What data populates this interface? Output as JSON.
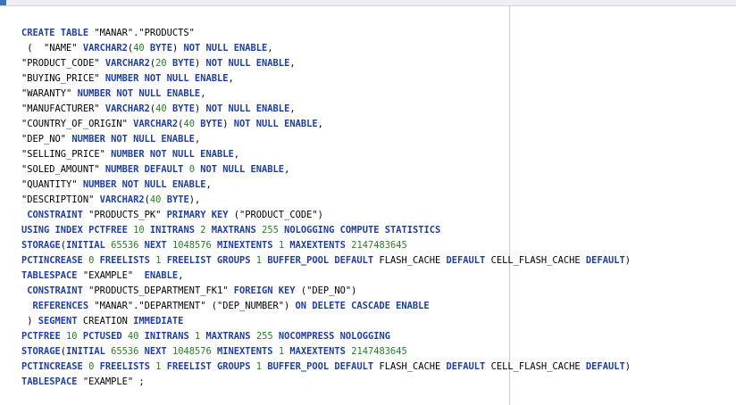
{
  "editor": {
    "lines": [
      [
        {
          "k": "kw",
          "t": "CREATE TABLE "
        },
        {
          "k": "txt",
          "t": "\"MANAR\".\"PRODUCTS\""
        }
      ],
      [
        {
          "k": "txt",
          "t": " (  \"NAME\" "
        },
        {
          "k": "kw",
          "t": "VARCHAR2"
        },
        {
          "k": "txt",
          "t": "("
        },
        {
          "k": "num",
          "t": "40"
        },
        {
          "k": "txt",
          "t": " "
        },
        {
          "k": "kw",
          "t": "BYTE"
        },
        {
          "k": "txt",
          "t": ") "
        },
        {
          "k": "kw",
          "t": "NOT NULL ENABLE"
        },
        {
          "k": "txt",
          "t": ","
        }
      ],
      [
        {
          "k": "txt",
          "t": "\"PRODUCT_CODE\" "
        },
        {
          "k": "kw",
          "t": "VARCHAR2"
        },
        {
          "k": "txt",
          "t": "("
        },
        {
          "k": "num",
          "t": "20"
        },
        {
          "k": "txt",
          "t": " "
        },
        {
          "k": "kw",
          "t": "BYTE"
        },
        {
          "k": "txt",
          "t": ") "
        },
        {
          "k": "kw",
          "t": "NOT NULL ENABLE"
        },
        {
          "k": "txt",
          "t": ","
        }
      ],
      [
        {
          "k": "txt",
          "t": "\"BUYING_PRICE\" "
        },
        {
          "k": "kw",
          "t": "NUMBER NOT NULL ENABLE"
        },
        {
          "k": "txt",
          "t": ","
        }
      ],
      [
        {
          "k": "txt",
          "t": "\"WARANTY\" "
        },
        {
          "k": "kw",
          "t": "NUMBER NOT NULL ENABLE"
        },
        {
          "k": "txt",
          "t": ","
        }
      ],
      [
        {
          "k": "txt",
          "t": "\"MANUFACTURER\" "
        },
        {
          "k": "kw",
          "t": "VARCHAR2"
        },
        {
          "k": "txt",
          "t": "("
        },
        {
          "k": "num",
          "t": "40"
        },
        {
          "k": "txt",
          "t": " "
        },
        {
          "k": "kw",
          "t": "BYTE"
        },
        {
          "k": "txt",
          "t": ") "
        },
        {
          "k": "kw",
          "t": "NOT NULL ENABLE"
        },
        {
          "k": "txt",
          "t": ","
        }
      ],
      [
        {
          "k": "txt",
          "t": "\"COUNTRY_OF_ORIGIN\" "
        },
        {
          "k": "kw",
          "t": "VARCHAR2"
        },
        {
          "k": "txt",
          "t": "("
        },
        {
          "k": "num",
          "t": "40"
        },
        {
          "k": "txt",
          "t": " "
        },
        {
          "k": "kw",
          "t": "BYTE"
        },
        {
          "k": "txt",
          "t": ") "
        },
        {
          "k": "kw",
          "t": "NOT NULL ENABLE"
        },
        {
          "k": "txt",
          "t": ","
        }
      ],
      [
        {
          "k": "txt",
          "t": "\"DEP_NO\" "
        },
        {
          "k": "kw",
          "t": "NUMBER NOT NULL ENABLE"
        },
        {
          "k": "txt",
          "t": ","
        }
      ],
      [
        {
          "k": "txt",
          "t": "\"SELLING_PRICE\" "
        },
        {
          "k": "kw",
          "t": "NUMBER NOT NULL ENABLE"
        },
        {
          "k": "txt",
          "t": ","
        }
      ],
      [
        {
          "k": "txt",
          "t": "\"SOLED_AMOUNT\" "
        },
        {
          "k": "kw",
          "t": "NUMBER DEFAULT "
        },
        {
          "k": "num",
          "t": "0"
        },
        {
          "k": "txt",
          "t": " "
        },
        {
          "k": "kw",
          "t": "NOT NULL ENABLE"
        },
        {
          "k": "txt",
          "t": ","
        }
      ],
      [
        {
          "k": "txt",
          "t": "\"QUANTITY\" "
        },
        {
          "k": "kw",
          "t": "NUMBER NOT NULL ENABLE"
        },
        {
          "k": "txt",
          "t": ","
        }
      ],
      [
        {
          "k": "txt",
          "t": "\"DESCRIPTION\" "
        },
        {
          "k": "kw",
          "t": "VARCHAR2"
        },
        {
          "k": "txt",
          "t": "("
        },
        {
          "k": "num",
          "t": "40"
        },
        {
          "k": "txt",
          "t": " "
        },
        {
          "k": "kw",
          "t": "BYTE"
        },
        {
          "k": "txt",
          "t": "),"
        }
      ],
      [
        {
          "k": "txt",
          "t": " "
        },
        {
          "k": "kw",
          "t": "CONSTRAINT"
        },
        {
          "k": "txt",
          "t": " \"PRODUCTS_PK\" "
        },
        {
          "k": "kw",
          "t": "PRIMARY KEY"
        },
        {
          "k": "txt",
          "t": " (\"PRODUCT_CODE\")"
        }
      ],
      [
        {
          "k": "kw",
          "t": "USING INDEX PCTFREE "
        },
        {
          "k": "num",
          "t": "10"
        },
        {
          "k": "txt",
          "t": " "
        },
        {
          "k": "kw",
          "t": "INITRANS "
        },
        {
          "k": "num",
          "t": "2"
        },
        {
          "k": "txt",
          "t": " "
        },
        {
          "k": "kw",
          "t": "MAXTRANS "
        },
        {
          "k": "num",
          "t": "255"
        },
        {
          "k": "txt",
          "t": " "
        },
        {
          "k": "kw",
          "t": "NOLOGGING COMPUTE STATISTICS"
        }
      ],
      [
        {
          "k": "kw",
          "t": "STORAGE"
        },
        {
          "k": "txt",
          "t": "("
        },
        {
          "k": "kw",
          "t": "INITIAL "
        },
        {
          "k": "num",
          "t": "65536"
        },
        {
          "k": "txt",
          "t": " "
        },
        {
          "k": "kw",
          "t": "NEXT "
        },
        {
          "k": "num",
          "t": "1048576"
        },
        {
          "k": "txt",
          "t": " "
        },
        {
          "k": "kw",
          "t": "MINEXTENTS "
        },
        {
          "k": "num",
          "t": "1"
        },
        {
          "k": "txt",
          "t": " "
        },
        {
          "k": "kw",
          "t": "MAXEXTENTS "
        },
        {
          "k": "num",
          "t": "2147483645"
        }
      ],
      [
        {
          "k": "kw",
          "t": "PCTINCREASE "
        },
        {
          "k": "num",
          "t": "0"
        },
        {
          "k": "txt",
          "t": " "
        },
        {
          "k": "kw",
          "t": "FREELISTS "
        },
        {
          "k": "num",
          "t": "1"
        },
        {
          "k": "txt",
          "t": " "
        },
        {
          "k": "kw",
          "t": "FREELIST GROUPS "
        },
        {
          "k": "num",
          "t": "1"
        },
        {
          "k": "txt",
          "t": " "
        },
        {
          "k": "kw",
          "t": "BUFFER_POOL DEFAULT"
        },
        {
          "k": "txt",
          "t": " FLASH_CACHE "
        },
        {
          "k": "kw",
          "t": "DEFAULT"
        },
        {
          "k": "txt",
          "t": " CELL_FLASH_CACHE "
        },
        {
          "k": "kw",
          "t": "DEFAULT"
        },
        {
          "k": "txt",
          "t": ")"
        }
      ],
      [
        {
          "k": "kw",
          "t": "TABLESPACE"
        },
        {
          "k": "txt",
          "t": " \"EXAMPLE\"  "
        },
        {
          "k": "kw",
          "t": "ENABLE"
        },
        {
          "k": "txt",
          "t": ","
        }
      ],
      [
        {
          "k": "txt",
          "t": " "
        },
        {
          "k": "kw",
          "t": "CONSTRAINT"
        },
        {
          "k": "txt",
          "t": " \"PRODUCTS_DEPARTMENT_FK1\" "
        },
        {
          "k": "kw",
          "t": "FOREIGN KEY"
        },
        {
          "k": "txt",
          "t": " (\"DEP_NO\")"
        }
      ],
      [
        {
          "k": "txt",
          "t": "  "
        },
        {
          "k": "kw",
          "t": "REFERENCES"
        },
        {
          "k": "txt",
          "t": " \"MANAR\".\"DEPARTMENT\" (\"DEP_NUMBER\") "
        },
        {
          "k": "kw",
          "t": "ON DELETE CASCADE ENABLE"
        }
      ],
      [
        {
          "k": "txt",
          "t": " ) "
        },
        {
          "k": "kw",
          "t": "SEGMENT"
        },
        {
          "k": "txt",
          "t": " CREATION "
        },
        {
          "k": "kw",
          "t": "IMMEDIATE"
        }
      ],
      [
        {
          "k": "kw",
          "t": "PCTFREE "
        },
        {
          "k": "num",
          "t": "10"
        },
        {
          "k": "txt",
          "t": " "
        },
        {
          "k": "kw",
          "t": "PCTUSED "
        },
        {
          "k": "num",
          "t": "40"
        },
        {
          "k": "txt",
          "t": " "
        },
        {
          "k": "kw",
          "t": "INITRANS "
        },
        {
          "k": "num",
          "t": "1"
        },
        {
          "k": "txt",
          "t": " "
        },
        {
          "k": "kw",
          "t": "MAXTRANS "
        },
        {
          "k": "num",
          "t": "255"
        },
        {
          "k": "txt",
          "t": " "
        },
        {
          "k": "kw",
          "t": "NOCOMPRESS NOLOGGING"
        }
      ],
      [
        {
          "k": "kw",
          "t": "STORAGE"
        },
        {
          "k": "txt",
          "t": "("
        },
        {
          "k": "kw",
          "t": "INITIAL "
        },
        {
          "k": "num",
          "t": "65536"
        },
        {
          "k": "txt",
          "t": " "
        },
        {
          "k": "kw",
          "t": "NEXT "
        },
        {
          "k": "num",
          "t": "1048576"
        },
        {
          "k": "txt",
          "t": " "
        },
        {
          "k": "kw",
          "t": "MINEXTENTS "
        },
        {
          "k": "num",
          "t": "1"
        },
        {
          "k": "txt",
          "t": " "
        },
        {
          "k": "kw",
          "t": "MAXEXTENTS "
        },
        {
          "k": "num",
          "t": "2147483645"
        }
      ],
      [
        {
          "k": "kw",
          "t": "PCTINCREASE "
        },
        {
          "k": "num",
          "t": "0"
        },
        {
          "k": "txt",
          "t": " "
        },
        {
          "k": "kw",
          "t": "FREELISTS "
        },
        {
          "k": "num",
          "t": "1"
        },
        {
          "k": "txt",
          "t": " "
        },
        {
          "k": "kw",
          "t": "FREELIST GROUPS "
        },
        {
          "k": "num",
          "t": "1"
        },
        {
          "k": "txt",
          "t": " "
        },
        {
          "k": "kw",
          "t": "BUFFER_POOL DEFAULT"
        },
        {
          "k": "txt",
          "t": " FLASH_CACHE "
        },
        {
          "k": "kw",
          "t": "DEFAULT"
        },
        {
          "k": "txt",
          "t": " CELL_FLASH_CACHE "
        },
        {
          "k": "kw",
          "t": "DEFAULT"
        },
        {
          "k": "txt",
          "t": ")"
        }
      ],
      [
        {
          "k": "kw",
          "t": "TABLESPACE"
        },
        {
          "k": "txt",
          "t": " \"EXAMPLE\" ;"
        }
      ]
    ]
  },
  "colors": {
    "keyword": "#1e3ea3",
    "number": "#258025",
    "text": "#000000",
    "background": "#ffffff"
  }
}
